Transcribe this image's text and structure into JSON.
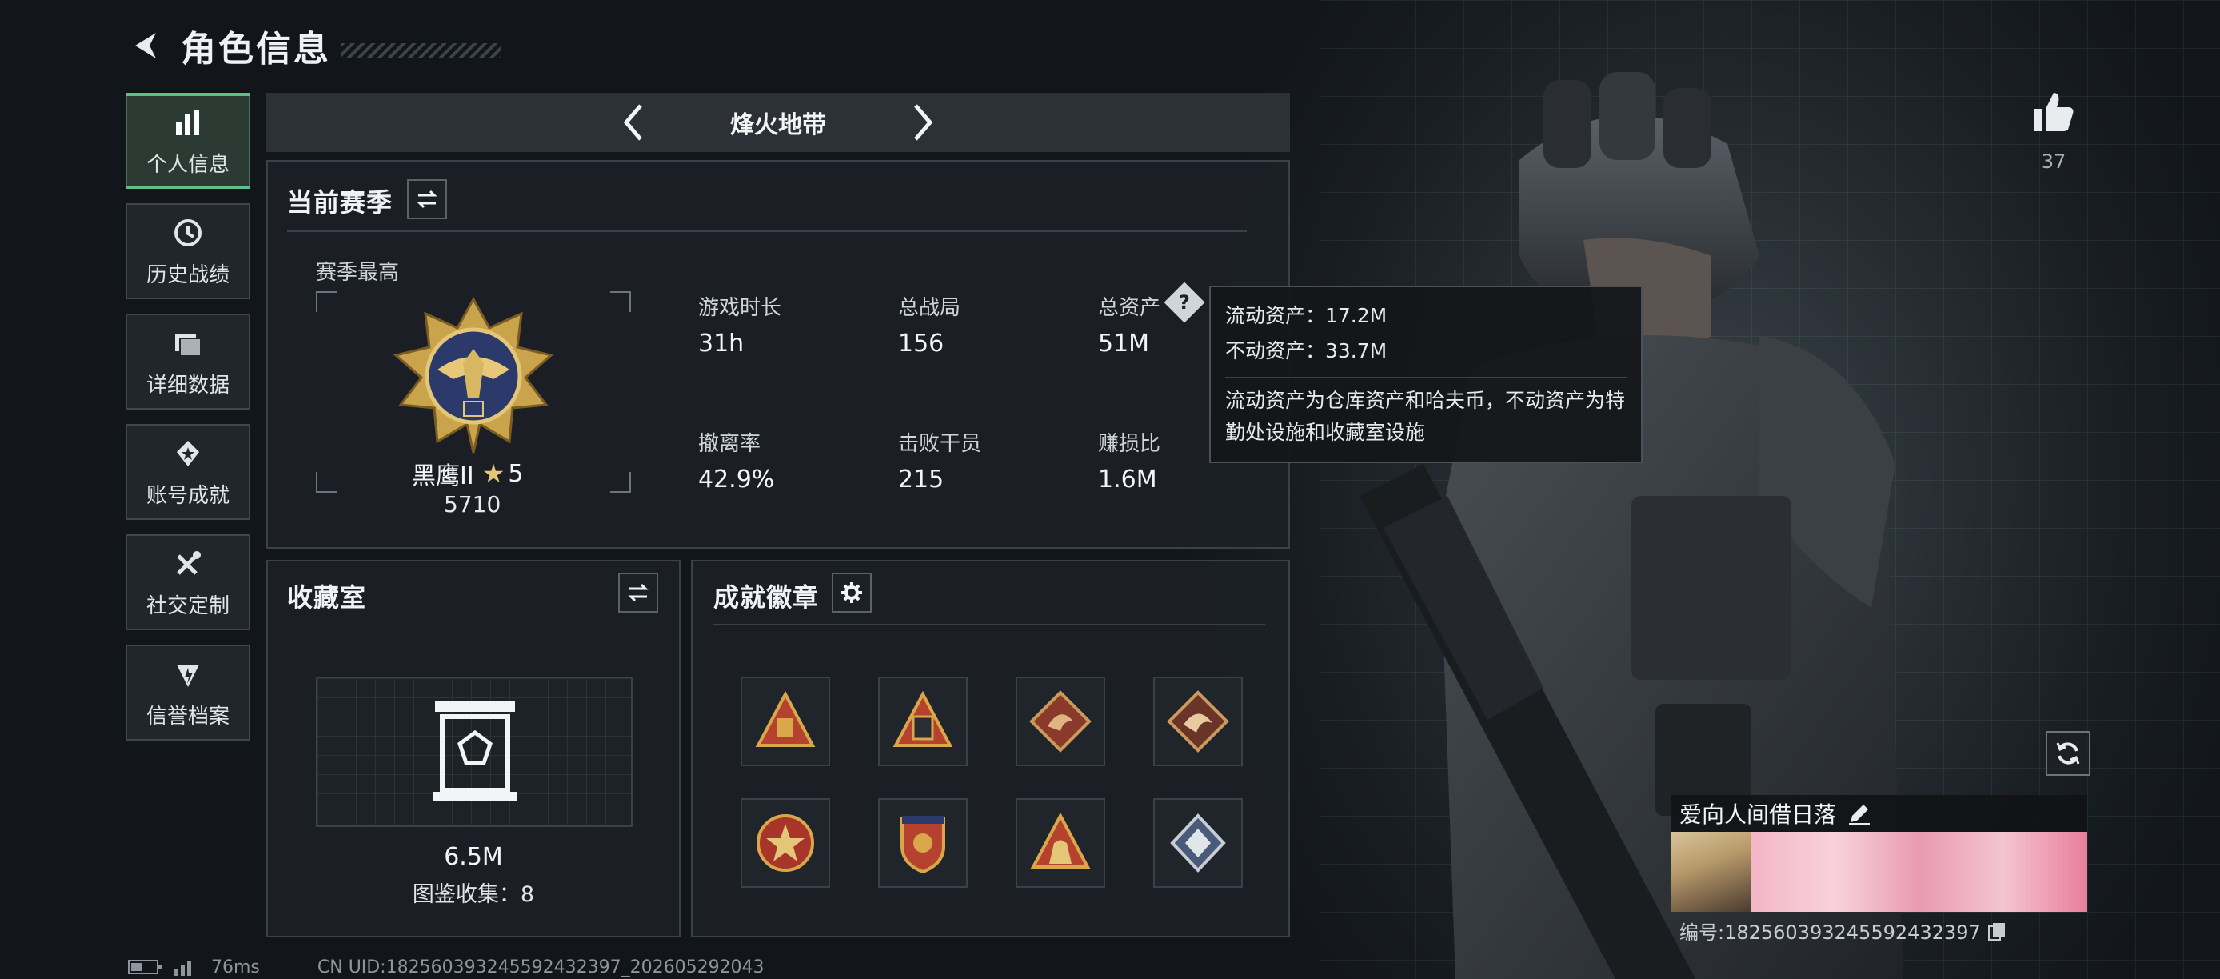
{
  "header": {
    "title": "角色信息"
  },
  "sidebar": {
    "items": [
      {
        "label": "个人信息",
        "icon": "bar-chart-icon"
      },
      {
        "label": "历史战绩",
        "icon": "history-icon"
      },
      {
        "label": "详细数据",
        "icon": "folder-icon"
      },
      {
        "label": "账号成就",
        "icon": "achievement-icon"
      },
      {
        "label": "社交定制",
        "icon": "tools-icon"
      },
      {
        "label": "信誉档案",
        "icon": "credibility-icon"
      }
    ]
  },
  "mode": {
    "label": "烽火地带"
  },
  "season": {
    "title": "当前赛季",
    "highest_label": "赛季最高",
    "rank_name": "黑鹰II",
    "stars": "5",
    "rank_points": "5710",
    "stats": [
      {
        "label": "游戏时长",
        "value": "31h"
      },
      {
        "label": "总战局",
        "value": "156"
      },
      {
        "label": "总资产",
        "value": "51M"
      },
      {
        "label": "撤离率",
        "value": "42.9%"
      },
      {
        "label": "击败干员",
        "value": "215"
      },
      {
        "label": "赚损比",
        "value": "1.6M"
      }
    ]
  },
  "tooltip": {
    "liquid": "流动资产：17.2M",
    "fixed": "不动资产：33.7M",
    "desc": "流动资产为仓库资产和哈夫币，不动资产为特勤处设施和收藏室设施"
  },
  "collection": {
    "title": "收藏室",
    "value": "6.5M",
    "catalog_label": "图鉴收集：",
    "catalog_value": "8"
  },
  "badges": {
    "title": "成就徽章",
    "items": [
      "badge-1",
      "badge-2",
      "badge-3",
      "badge-4",
      "badge-5",
      "badge-6",
      "badge-7",
      "badge-8"
    ]
  },
  "like": {
    "count": "37"
  },
  "player": {
    "name": "爱向人间借日落",
    "uid": "编号:1825603932455924323​97"
  },
  "status": {
    "ping": "76ms",
    "cn_uid": "CN UID:182560393245592432397_202605292043"
  },
  "colors": {
    "accent": "#5fbf8a",
    "gold": "#c9a44c",
    "panel": "#1c2126"
  }
}
